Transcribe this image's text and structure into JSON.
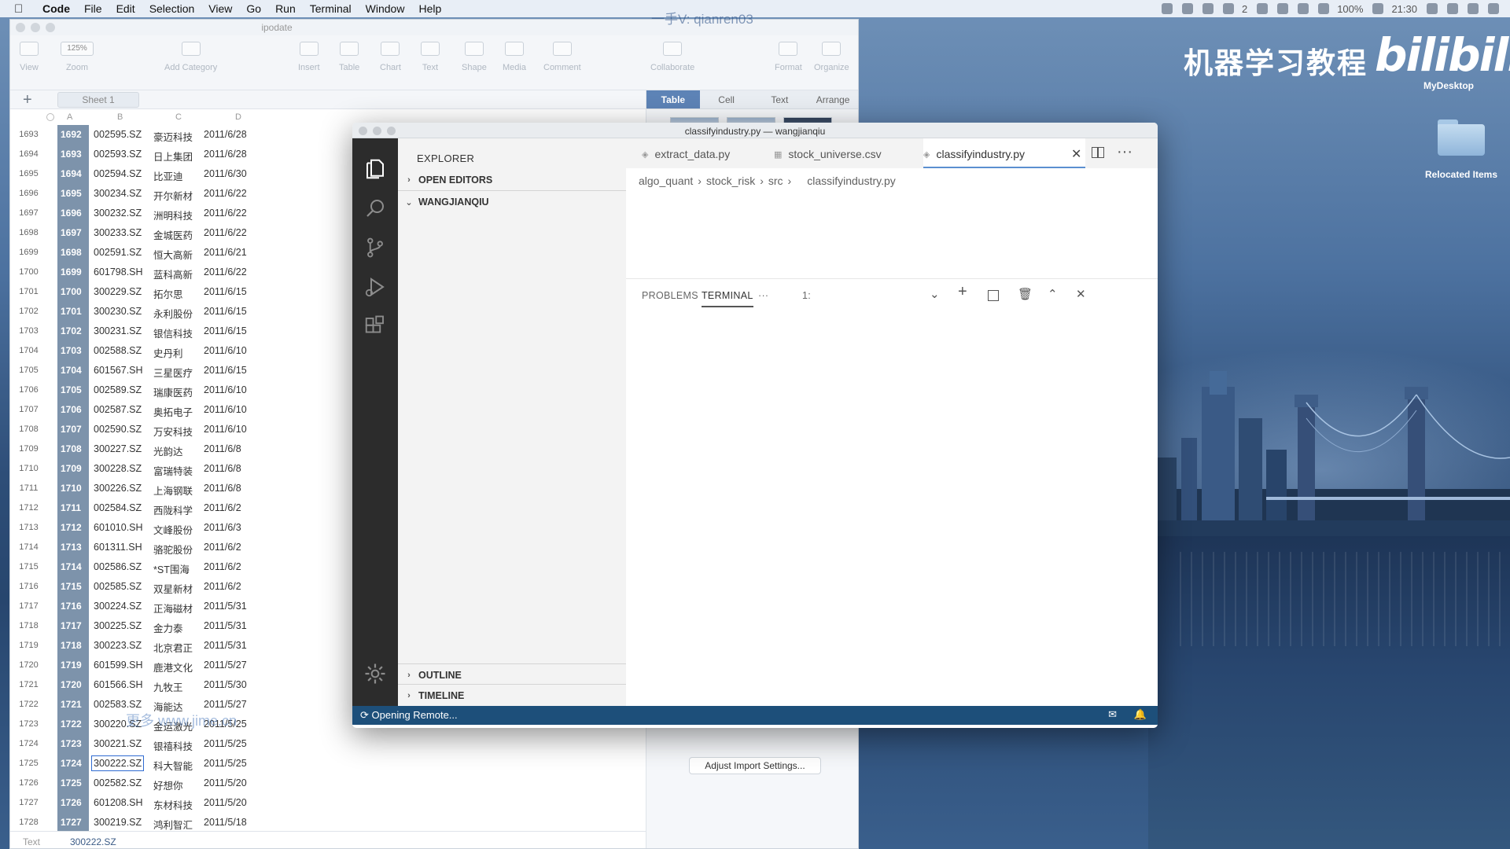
{
  "menubar": {
    "items": [
      "Code",
      "File",
      "Edit",
      "Selection",
      "View",
      "Go",
      "Run",
      "Terminal",
      "Window",
      "Help"
    ],
    "overlay_user": "一手V: qianren03",
    "status": {
      "battery": "100%",
      "time": "21:30",
      "wifi_count": "2"
    }
  },
  "desktop": {
    "title": "机器学习教程",
    "logo": "bilibili",
    "mydesktop": "MyDesktop",
    "folder_label": "Relocated Items"
  },
  "numbers": {
    "window_title": "ipodate",
    "toolbar": [
      {
        "icon": "view-icon",
        "label": "View"
      },
      {
        "icon": "zoom-icon",
        "label": "Zoom",
        "value": "125%"
      },
      {
        "icon": "add-category-icon",
        "label": "Add Category"
      },
      {
        "icon": "insert-icon",
        "label": "Insert"
      },
      {
        "icon": "table-icon",
        "label": "Table"
      },
      {
        "icon": "chart-icon",
        "label": "Chart"
      },
      {
        "icon": "text-icon",
        "label": "Text"
      },
      {
        "icon": "shape-icon",
        "label": "Shape"
      },
      {
        "icon": "media-icon",
        "label": "Media"
      },
      {
        "icon": "comment-icon",
        "label": "Comment"
      },
      {
        "icon": "collaborate-icon",
        "label": "Collaborate"
      },
      {
        "icon": "format-icon",
        "label": "Format"
      },
      {
        "icon": "organize-icon",
        "label": "Organize"
      }
    ],
    "sheet_tab": "Sheet 1",
    "columns": [
      "A",
      "B",
      "C",
      "D"
    ],
    "side_tabs": [
      "Table",
      "Cell",
      "Text",
      "Arrange"
    ],
    "adjust_button": "Adjust Import Settings...",
    "watermark": "更多 www.jime.cn",
    "formula_label": "Text",
    "formula_value": "300222.SZ",
    "rows": [
      {
        "n": "1693",
        "a": "1692",
        "b": "002595.SZ",
        "c": "豪迈科技",
        "d": "2011/6/28"
      },
      {
        "n": "1694",
        "a": "1693",
        "b": "002593.SZ",
        "c": "日上集团",
        "d": "2011/6/28"
      },
      {
        "n": "1695",
        "a": "1694",
        "b": "002594.SZ",
        "c": "比亚迪",
        "d": "2011/6/30"
      },
      {
        "n": "1696",
        "a": "1695",
        "b": "300234.SZ",
        "c": "开尔新材",
        "d": "2011/6/22"
      },
      {
        "n": "1697",
        "a": "1696",
        "b": "300232.SZ",
        "c": "洲明科技",
        "d": "2011/6/22"
      },
      {
        "n": "1698",
        "a": "1697",
        "b": "300233.SZ",
        "c": "金城医药",
        "d": "2011/6/22"
      },
      {
        "n": "1699",
        "a": "1698",
        "b": "002591.SZ",
        "c": "恒大高新",
        "d": "2011/6/21"
      },
      {
        "n": "1700",
        "a": "1699",
        "b": "601798.SH",
        "c": "蓝科高新",
        "d": "2011/6/22"
      },
      {
        "n": "1701",
        "a": "1700",
        "b": "300229.SZ",
        "c": "拓尔思",
        "d": "2011/6/15"
      },
      {
        "n": "1702",
        "a": "1701",
        "b": "300230.SZ",
        "c": "永利股份",
        "d": "2011/6/15"
      },
      {
        "n": "1703",
        "a": "1702",
        "b": "300231.SZ",
        "c": "银信科技",
        "d": "2011/6/15"
      },
      {
        "n": "1704",
        "a": "1703",
        "b": "002588.SZ",
        "c": "史丹利",
        "d": "2011/6/10"
      },
      {
        "n": "1705",
        "a": "1704",
        "b": "601567.SH",
        "c": "三星医疗",
        "d": "2011/6/15"
      },
      {
        "n": "1706",
        "a": "1705",
        "b": "002589.SZ",
        "c": "瑞康医药",
        "d": "2011/6/10"
      },
      {
        "n": "1707",
        "a": "1706",
        "b": "002587.SZ",
        "c": "奥拓电子",
        "d": "2011/6/10"
      },
      {
        "n": "1708",
        "a": "1707",
        "b": "002590.SZ",
        "c": "万安科技",
        "d": "2011/6/10"
      },
      {
        "n": "1709",
        "a": "1708",
        "b": "300227.SZ",
        "c": "光韵达",
        "d": "2011/6/8"
      },
      {
        "n": "1710",
        "a": "1709",
        "b": "300228.SZ",
        "c": "富瑞特装",
        "d": "2011/6/8"
      },
      {
        "n": "1711",
        "a": "1710",
        "b": "300226.SZ",
        "c": "上海钢联",
        "d": "2011/6/8"
      },
      {
        "n": "1712",
        "a": "1711",
        "b": "002584.SZ",
        "c": "西陇科学",
        "d": "2011/6/2"
      },
      {
        "n": "1713",
        "a": "1712",
        "b": "601010.SH",
        "c": "文峰股份",
        "d": "2011/6/3"
      },
      {
        "n": "1714",
        "a": "1713",
        "b": "601311.SH",
        "c": "骆驼股份",
        "d": "2011/6/2"
      },
      {
        "n": "1715",
        "a": "1714",
        "b": "002586.SZ",
        "c": "*ST围海",
        "d": "2011/6/2"
      },
      {
        "n": "1716",
        "a": "1715",
        "b": "002585.SZ",
        "c": "双星新材",
        "d": "2011/6/2"
      },
      {
        "n": "1717",
        "a": "1716",
        "b": "300224.SZ",
        "c": "正海磁材",
        "d": "2011/5/31"
      },
      {
        "n": "1718",
        "a": "1717",
        "b": "300225.SZ",
        "c": "金力泰",
        "d": "2011/5/31"
      },
      {
        "n": "1719",
        "a": "1718",
        "b": "300223.SZ",
        "c": "北京君正",
        "d": "2011/5/31"
      },
      {
        "n": "1720",
        "a": "1719",
        "b": "601599.SH",
        "c": "鹿港文化",
        "d": "2011/5/27"
      },
      {
        "n": "1721",
        "a": "1720",
        "b": "601566.SH",
        "c": "九牧王",
        "d": "2011/5/30"
      },
      {
        "n": "1722",
        "a": "1721",
        "b": "002583.SZ",
        "c": "海能达",
        "d": "2011/5/27"
      },
      {
        "n": "1723",
        "a": "1722",
        "b": "300220.SZ",
        "c": "金运激光",
        "d": "2011/5/25"
      },
      {
        "n": "1724",
        "a": "1723",
        "b": "300221.SZ",
        "c": "银禧科技",
        "d": "2011/5/25"
      },
      {
        "n": "1725",
        "a": "1724",
        "b": "300222.SZ",
        "c": "科大智能",
        "d": "2011/5/25",
        "selected": true
      },
      {
        "n": "1726",
        "a": "1725",
        "b": "002582.SZ",
        "c": "好想你",
        "d": "2011/5/20"
      },
      {
        "n": "1727",
        "a": "1726",
        "b": "601208.SH",
        "c": "东材科技",
        "d": "2011/5/20"
      },
      {
        "n": "1728",
        "a": "1727",
        "b": "300219.SZ",
        "c": "鸿利智汇",
        "d": "2011/5/18"
      }
    ]
  },
  "vscode": {
    "window_title": "classifyindustry.py — wangjianqiu",
    "explorer_title": "EXPLORER",
    "sections": {
      "open_editors": "OPEN EDITORS",
      "folder": "WANGJIANQIU",
      "outline": "OUTLINE",
      "timeline": "TIMELINE"
    },
    "tabs": [
      "extract_data.py",
      "stock_universe.csv",
      "classifyindustry.py"
    ],
    "breadcrumb": [
      "algo_quant",
      "stock_risk",
      "src",
      "classifyindustry.py"
    ],
    "panel_tabs": {
      "problems": "PROBLEMS",
      "terminal": "TERMINAL",
      "more": "···",
      "instance": "1:"
    },
    "status_remote": "Opening Remote..."
  }
}
